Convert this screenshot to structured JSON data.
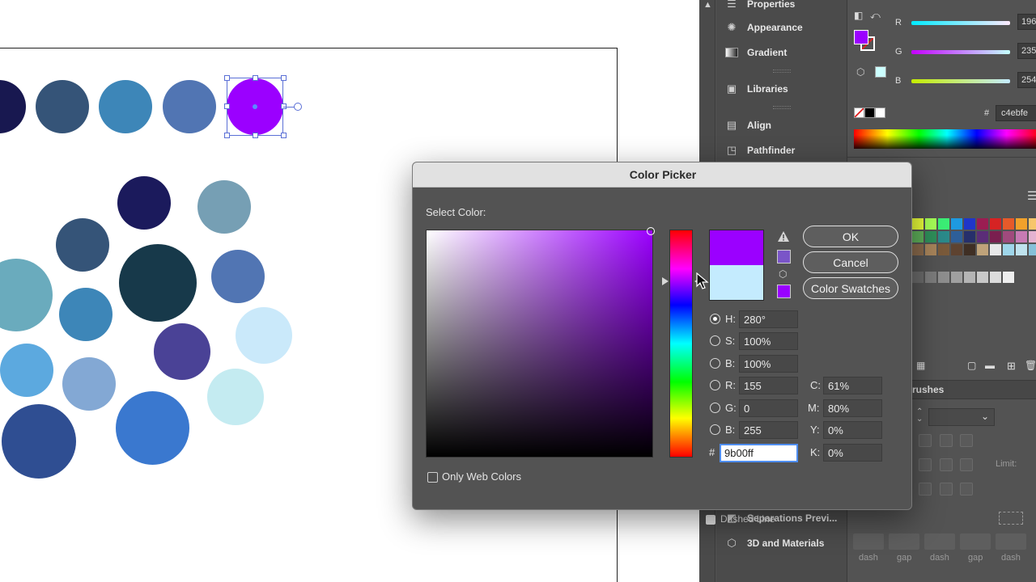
{
  "colors": {
    "selected_purple": "#9b00ff",
    "current_light_blue": "#c4ebfe",
    "panel_bg": "#535353"
  },
  "dialog": {
    "title": "Color Picker",
    "select_color_label": "Select Color:",
    "buttons": {
      "ok": "OK",
      "cancel": "Cancel",
      "swatches": "Color Swatches"
    },
    "hsb": {
      "h_label": "H:",
      "h_value": "280°",
      "s_label": "S:",
      "s_value": "100%",
      "b_label": "B:",
      "b_value": "100%"
    },
    "rgb": {
      "r_label": "R:",
      "r_value": "155",
      "g_label": "G:",
      "g_value": "0",
      "b_label": "B:",
      "b_value": "255"
    },
    "cmyk": {
      "c_label": "C:",
      "c_value": "61%",
      "m_label": "M:",
      "m_value": "80%",
      "y_label": "Y:",
      "y_value": "0%",
      "k_label": "K:",
      "k_value": "0%"
    },
    "hex_symbol": "#",
    "hex_value": "9b00ff",
    "only_web_colors": "Only Web Colors",
    "selected_mode": "H"
  },
  "panels": {
    "items": [
      {
        "label": "Properties",
        "icon": "properties-icon"
      },
      {
        "label": "Appearance",
        "icon": "appearance-icon"
      },
      {
        "label": "Gradient",
        "icon": "gradient-icon"
      },
      {
        "label": "Libraries",
        "icon": "libraries-icon"
      },
      {
        "label": "Align",
        "icon": "align-icon"
      },
      {
        "label": "Pathfinder",
        "icon": "pathfinder-icon"
      },
      {
        "label": "Separations Previ...",
        "icon": "separations-icon"
      },
      {
        "label": "3D and Materials",
        "icon": "3d-materials-icon"
      }
    ]
  },
  "color_panel": {
    "r_label": "R",
    "r_value": "196",
    "g_label": "G",
    "g_value": "235",
    "b_label": "B",
    "b_value": "254",
    "hex_symbol": "#",
    "hex_value": "c4ebfe"
  },
  "brushes_tab": "rushes",
  "stroke_panel": {
    "limit_label": "Limit:",
    "dashed_line_label": "Dashed Line",
    "dash_labels": [
      "dash",
      "gap",
      "dash",
      "gap",
      "dash"
    ]
  }
}
